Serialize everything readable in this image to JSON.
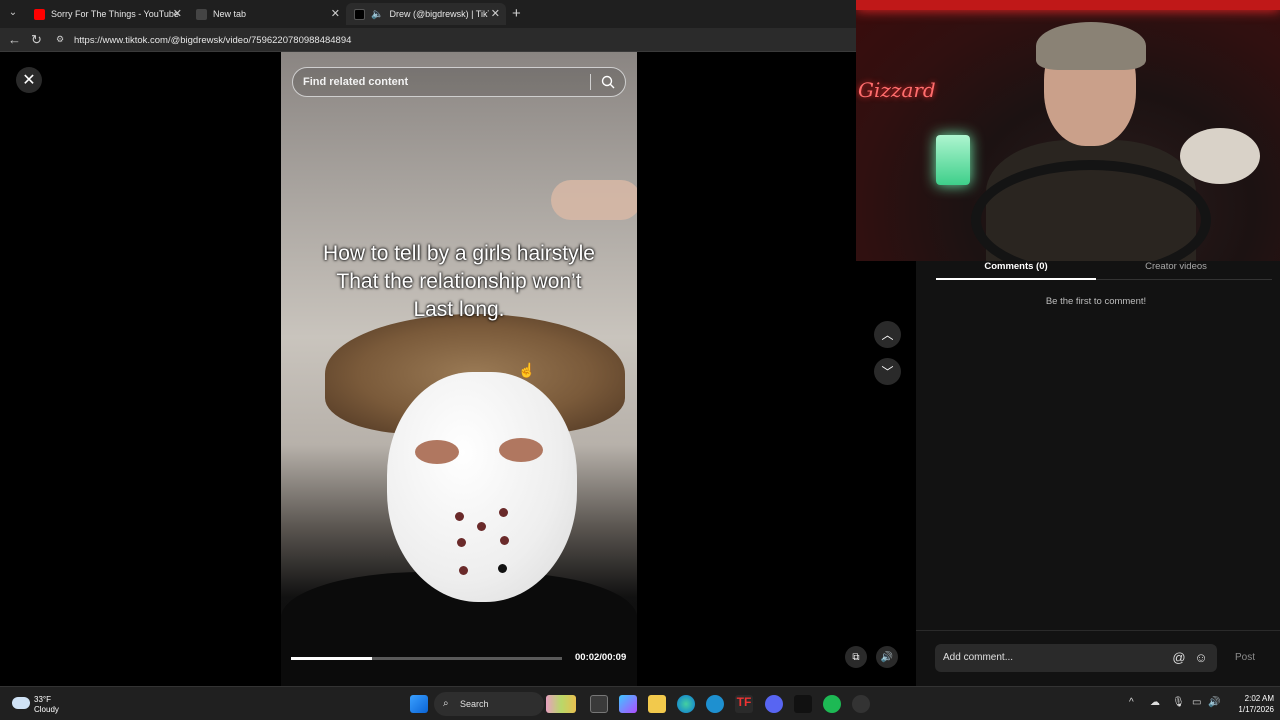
{
  "browser": {
    "tabs": [
      {
        "label": "Sorry For The Things - YouTube",
        "color": "#ff0000",
        "active": false
      },
      {
        "label": "New tab",
        "color": "#1f1f1f",
        "active": false
      },
      {
        "label": "Drew   (@bigdrewsk) | TikT",
        "color": "#000000",
        "active": true
      }
    ],
    "new_tab_icon": "plus-icon",
    "url": "https://www.tiktok.com/@bigdrewsk/video/7596220780988484894"
  },
  "video": {
    "search_placeholder": "Find related content",
    "caption_lines": [
      "How to tell by a girls hairstyle",
      "That the relationship won’t",
      "Last long."
    ],
    "progress": 0.3,
    "time": "00:02/00:09"
  },
  "webcam": {
    "neon_sign": "Gizzard"
  },
  "comments": {
    "tab_comments": "Comments (0)",
    "tab_creator": "Creator videos",
    "empty_message": "Be the first to comment!",
    "input_placeholder": "Add comment...",
    "post_label": "Post"
  },
  "taskbar": {
    "temperature": "33°F",
    "condition": "Cloudy",
    "search_label": "Search",
    "time": "2:02 AM",
    "date": "1/17/2026"
  },
  "colors": {
    "accent": "#fe2c55",
    "panel": "#121212"
  }
}
